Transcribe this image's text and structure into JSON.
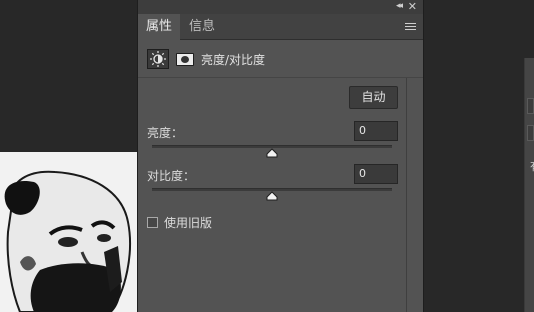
{
  "panel": {
    "tabs": [
      {
        "label": "属性"
      },
      {
        "label": "信息"
      }
    ],
    "collapse_glyph": "◂◂",
    "close_glyph": "✕",
    "adjustment_title": "亮度/对比度",
    "auto_label": "自动",
    "brightness": {
      "label": "亮度：",
      "value": "0"
    },
    "contrast": {
      "label": "对比度：",
      "value": "0"
    },
    "legacy_label": "使用旧版"
  },
  "right_panel": {
    "glyph": "有"
  },
  "icons": [
    "collapse-icon",
    "close-icon",
    "panel-menu-icon",
    "brightness-contrast-icon",
    "layer-mask-icon"
  ]
}
